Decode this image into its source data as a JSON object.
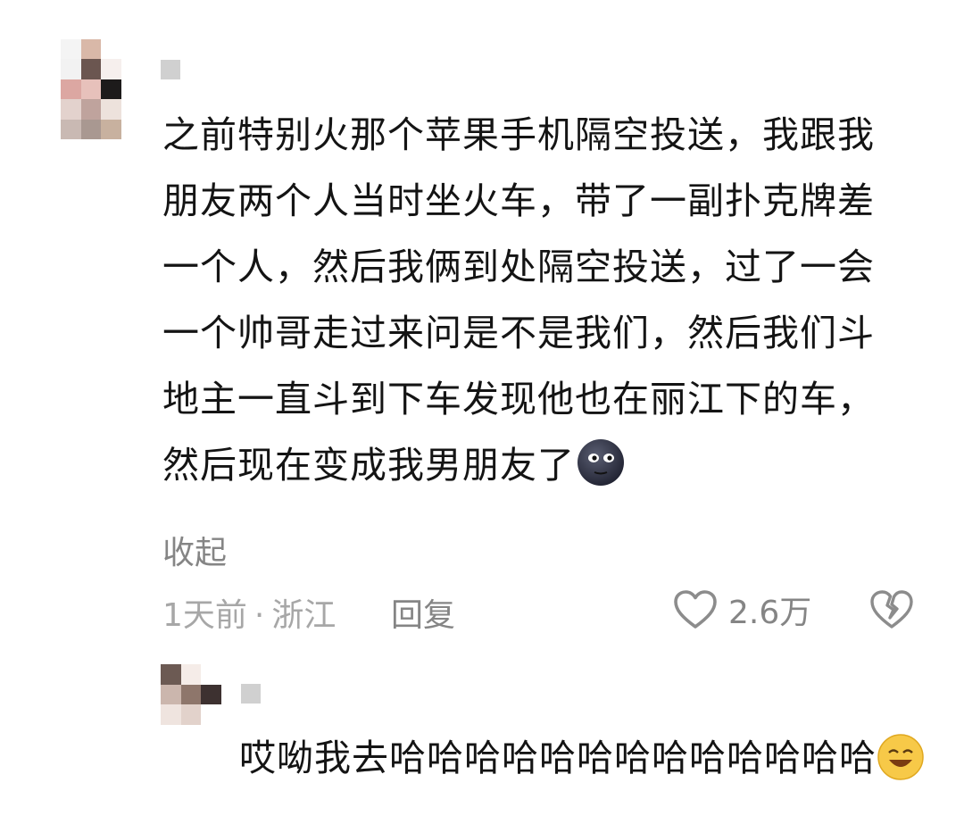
{
  "comment": {
    "text": "之前特别火那个苹果手机隔空投送，我跟我朋友两个人当时坐火车，带了一副扑克牌差一个人，然后我俩到处隔空投送，过了一会一个帅哥走过来问是不是我们，然后我们斗地主一直斗到下车发现他也在丽江下的车，然后现在变成我男朋友了",
    "emoji": "moon-face-emoji",
    "collapse_label": "收起",
    "time": "1天前",
    "separator": "·",
    "location": "浙江",
    "reply_label": "回复",
    "like_count": "2.6万",
    "like_icon": "heart-outline-icon",
    "dislike_icon": "broken-heart-icon"
  },
  "reply": {
    "text": "哎呦我去哈哈哈哈哈哈哈哈哈哈哈哈哈",
    "emoji": "laughing-emoji"
  },
  "colors": {
    "text": "#141414",
    "secondary": "#858585",
    "muted": "#a7a7a7"
  }
}
